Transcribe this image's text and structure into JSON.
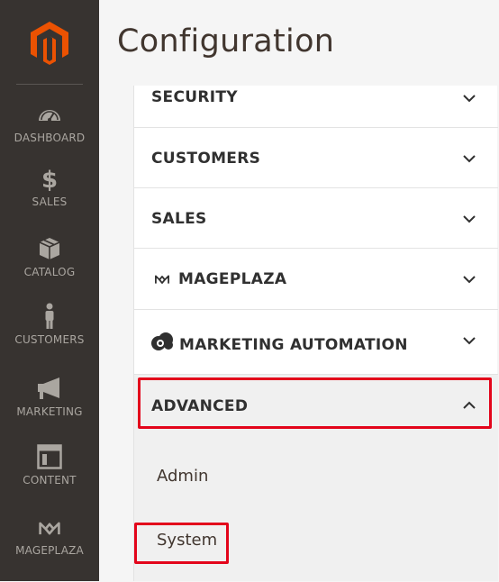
{
  "header": {
    "title": "Configuration"
  },
  "sidebar": {
    "items": [
      {
        "label": "DASHBOARD",
        "icon": "dashboard-icon"
      },
      {
        "label": "SALES",
        "icon": "dollar-icon"
      },
      {
        "label": "CATALOG",
        "icon": "box-icon"
      },
      {
        "label": "CUSTOMERS",
        "icon": "person-icon"
      },
      {
        "label": "MARKETING",
        "icon": "megaphone-icon"
      },
      {
        "label": "CONTENT",
        "icon": "layout-icon"
      },
      {
        "label": "MAGEPLAZA",
        "icon": "mageplaza-icon"
      }
    ]
  },
  "sections": [
    {
      "title": "SECURITY",
      "expanded": false
    },
    {
      "title": "CUSTOMERS",
      "expanded": false
    },
    {
      "title": "SALES",
      "expanded": false
    },
    {
      "title": "MAGEPLAZA",
      "expanded": false,
      "icon": "mageplaza-icon"
    },
    {
      "title": "MARKETING AUTOMATION",
      "expanded": false,
      "icon": "cloud-icon"
    },
    {
      "title": "ADVANCED",
      "expanded": true
    }
  ],
  "advanced_items": [
    {
      "label": "Admin"
    },
    {
      "label": "System"
    }
  ],
  "colors": {
    "sidebar_bg": "#373330",
    "brand_orange": "#eb5202",
    "highlight_red": "#e3051b"
  }
}
